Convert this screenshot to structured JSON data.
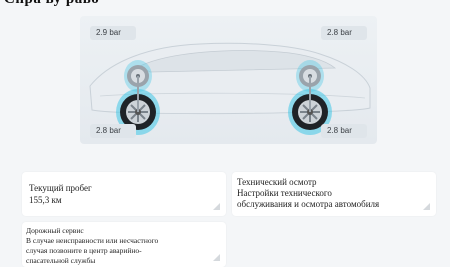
{
  "page": {
    "heading": "Спра  ву  раво"
  },
  "tires": {
    "front_left": "2.9 bar",
    "front_right": "2.8 bar",
    "rear_left": "2.8 bar",
    "rear_right": "2.8 bar"
  },
  "cards": {
    "mileage": {
      "title": "Текущий пробег",
      "value": "155,3 км"
    },
    "maintenance": {
      "title": "Технический осмотр",
      "line1": "Настройки технического",
      "line2": "обслуживания и осмотра автомобиля"
    },
    "roadside": {
      "title": "Дорожный сервис",
      "line1": "В случае неисправности или несчастного",
      "line2": "случая позвоните в центр аварийно-",
      "line3": "спасательной службы"
    }
  },
  "colors": {
    "tire_glow": "#3fc7e6",
    "card_bg": "#ffffff",
    "page_bg": "#f4f6f8"
  }
}
